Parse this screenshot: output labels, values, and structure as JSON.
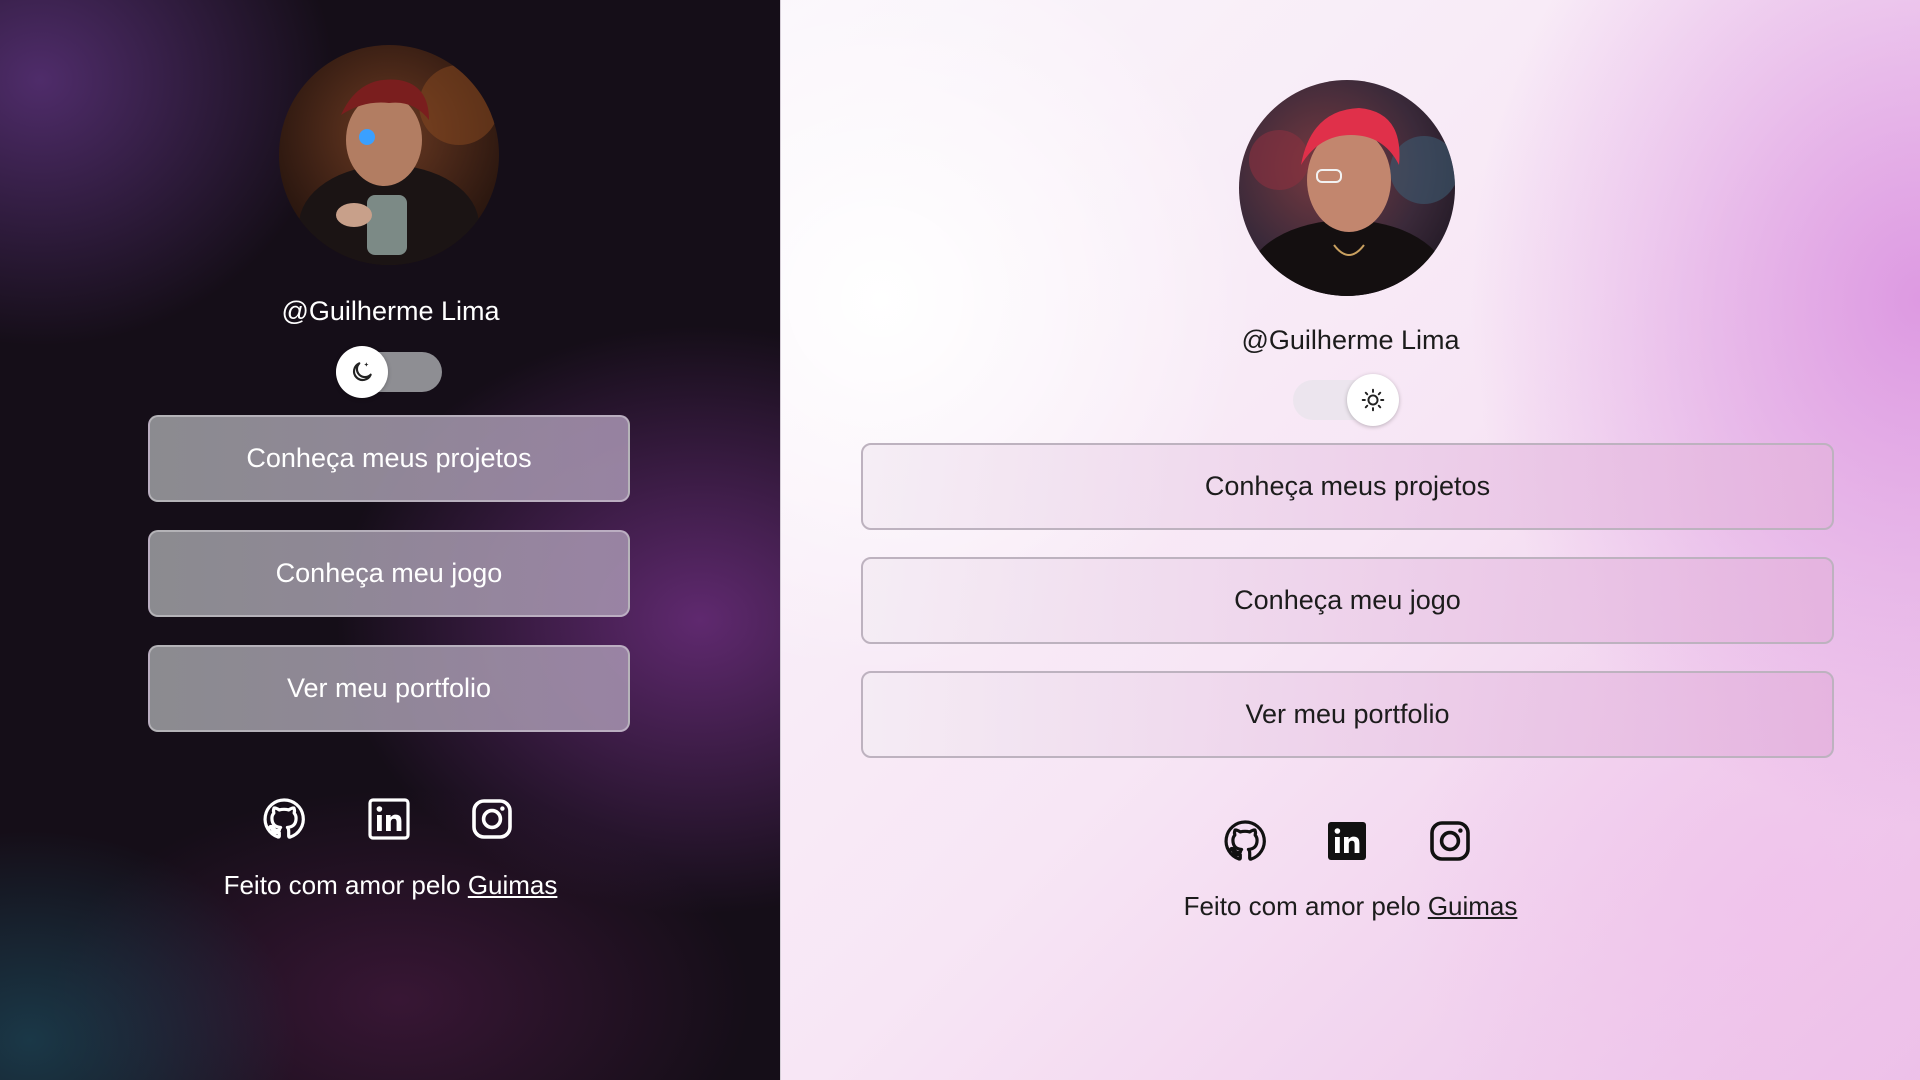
{
  "profile": {
    "username": "@Guilherme Lima"
  },
  "links": {
    "projects_label": "Conheça meus projetos",
    "game_label": "Conheça meu jogo",
    "portfolio_label": "Ver meu portfolio"
  },
  "social": [
    {
      "icon": "github-icon"
    },
    {
      "icon": "linkedin-icon"
    },
    {
      "icon": "instagram-icon"
    }
  ],
  "footer": {
    "text": "Feito com amor pelo ",
    "link_label": "Guimas"
  },
  "themes": {
    "dark": {
      "toggle_icon": "moon-icon",
      "text_color": "#ffffff",
      "button_fill": "#9a96a0"
    },
    "light": {
      "toggle_icon": "sun-icon",
      "text_color": "#1c1c1c",
      "button_fill": "#efe3ef"
    }
  }
}
